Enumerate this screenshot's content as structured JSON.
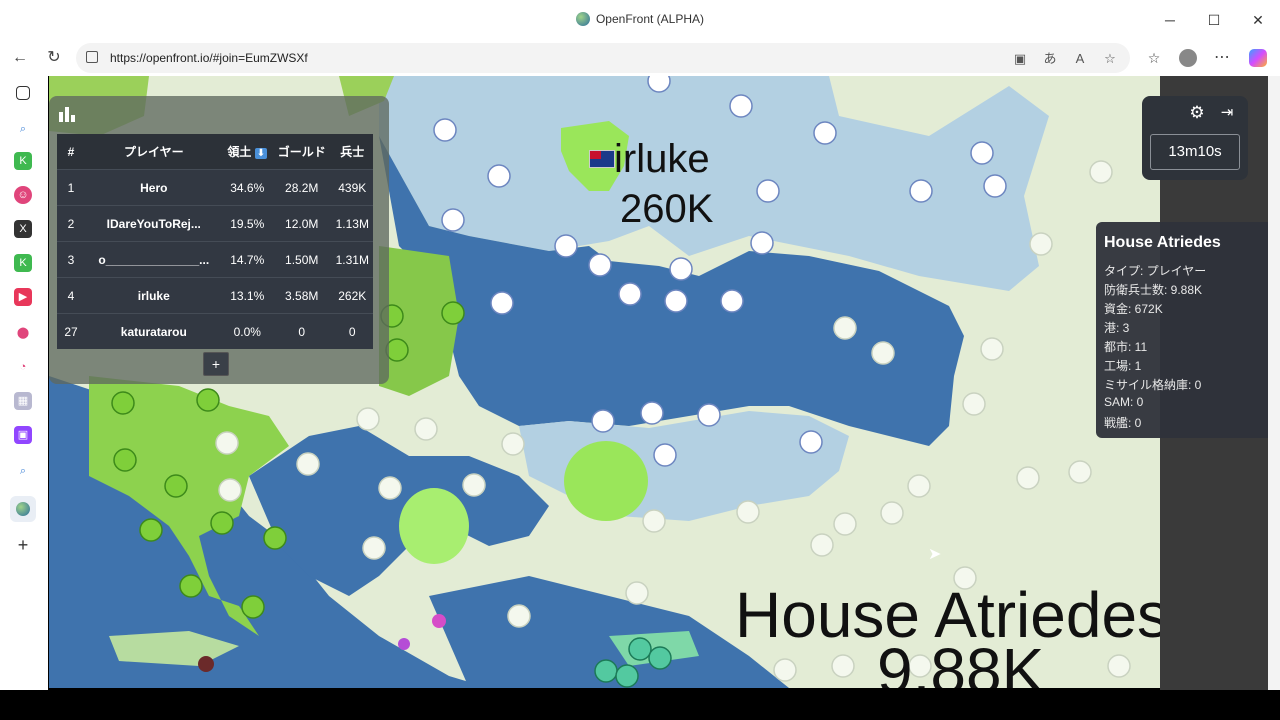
{
  "window": {
    "title": "OpenFront (ALPHA)",
    "minimize_glyph": "─",
    "maximize_glyph": "☐",
    "close_glyph": "✕"
  },
  "browser": {
    "url": "https://openfront.io/#join=EumZWSXf",
    "back_glyph": "←",
    "reload_glyph": "↻",
    "menu_glyph": "⋯"
  },
  "leaderboard": {
    "headers": [
      "#",
      "プレイヤー",
      "領土",
      "ゴールド",
      "兵士"
    ],
    "sort_indicator": "⬇",
    "rows": [
      {
        "rank": "1",
        "name": "Hero",
        "territory": "34.6%",
        "gold": "28.2M",
        "troops": "439K"
      },
      {
        "rank": "2",
        "name": "IDareYouToRej...",
        "territory": "19.5%",
        "gold": "12.0M",
        "troops": "1.13M"
      },
      {
        "rank": "3",
        "name": "o______________...",
        "territory": "14.7%",
        "gold": "1.50M",
        "troops": "1.31M"
      },
      {
        "rank": "4",
        "name": "irluke",
        "territory": "13.1%",
        "gold": "3.58M",
        "troops": "262K"
      },
      {
        "rank": "27",
        "name": "katuratarou",
        "territory": "0.0%",
        "gold": "0",
        "troops": "0"
      }
    ],
    "expand_label": "+"
  },
  "controls": {
    "timer": "13m10s",
    "settings_glyph": "⚙",
    "exit_glyph": "⇥"
  },
  "player_info": {
    "name": "House Atriedes",
    "rows": [
      "タイプ: プレイヤー",
      "防衛兵士数: 9.88K",
      "資金: 672K",
      "港: 3",
      "都市: 11",
      "工場: 1",
      "ミサイル格納庫: 0",
      "SAM: 0",
      "戦艦: 0"
    ]
  },
  "map_labels": {
    "irluke_name": "irluke",
    "irluke_troops": "260K",
    "atriedes_name": "House Atriedes",
    "atriedes_troops": "9.88K"
  },
  "colors": {
    "sea": "#3f73ad",
    "shallow": "#a8cce0",
    "land": "#e6efd8",
    "player_green": "#86d34a",
    "panel": "#323842"
  }
}
